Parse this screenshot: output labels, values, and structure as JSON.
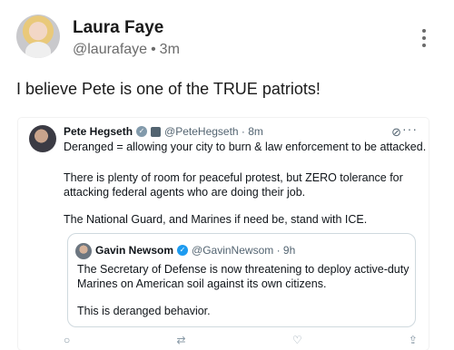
{
  "author": {
    "name": "Laura Faye",
    "handle": "@laurafaye",
    "separator": "•",
    "time": "3m"
  },
  "post_text": "I believe Pete is one of the TRUE patriots!",
  "embed": {
    "author_name": "Pete Hegseth",
    "handle_time": "@PeteHegseth · 8m",
    "lines": [
      "Deranged = allowing your city to burn & law enforcement to be attacked.",
      "There is plenty of room for peaceful protest, but ZERO tolerance for",
      "attacking federal agents who are doing their job.",
      "The National Guard, and Marines if need be, stand with ICE."
    ],
    "icons": [
      "verified-gray-icon",
      "government-badge-icon",
      "grok-icon",
      "more-icon"
    ],
    "quote": {
      "author_name": "Gavin Newsom",
      "handle_time": "@GavinNewsom · 9h",
      "lines": [
        "The Secretary of Defense is now threatening to deploy active-duty",
        "Marines on American soil against its own citizens.",
        "This is deranged behavior."
      ]
    }
  },
  "colors": {
    "verified_blue": "#1d9bf0",
    "verified_gray": "#829aab",
    "meta_text": "#6b6b6b"
  }
}
